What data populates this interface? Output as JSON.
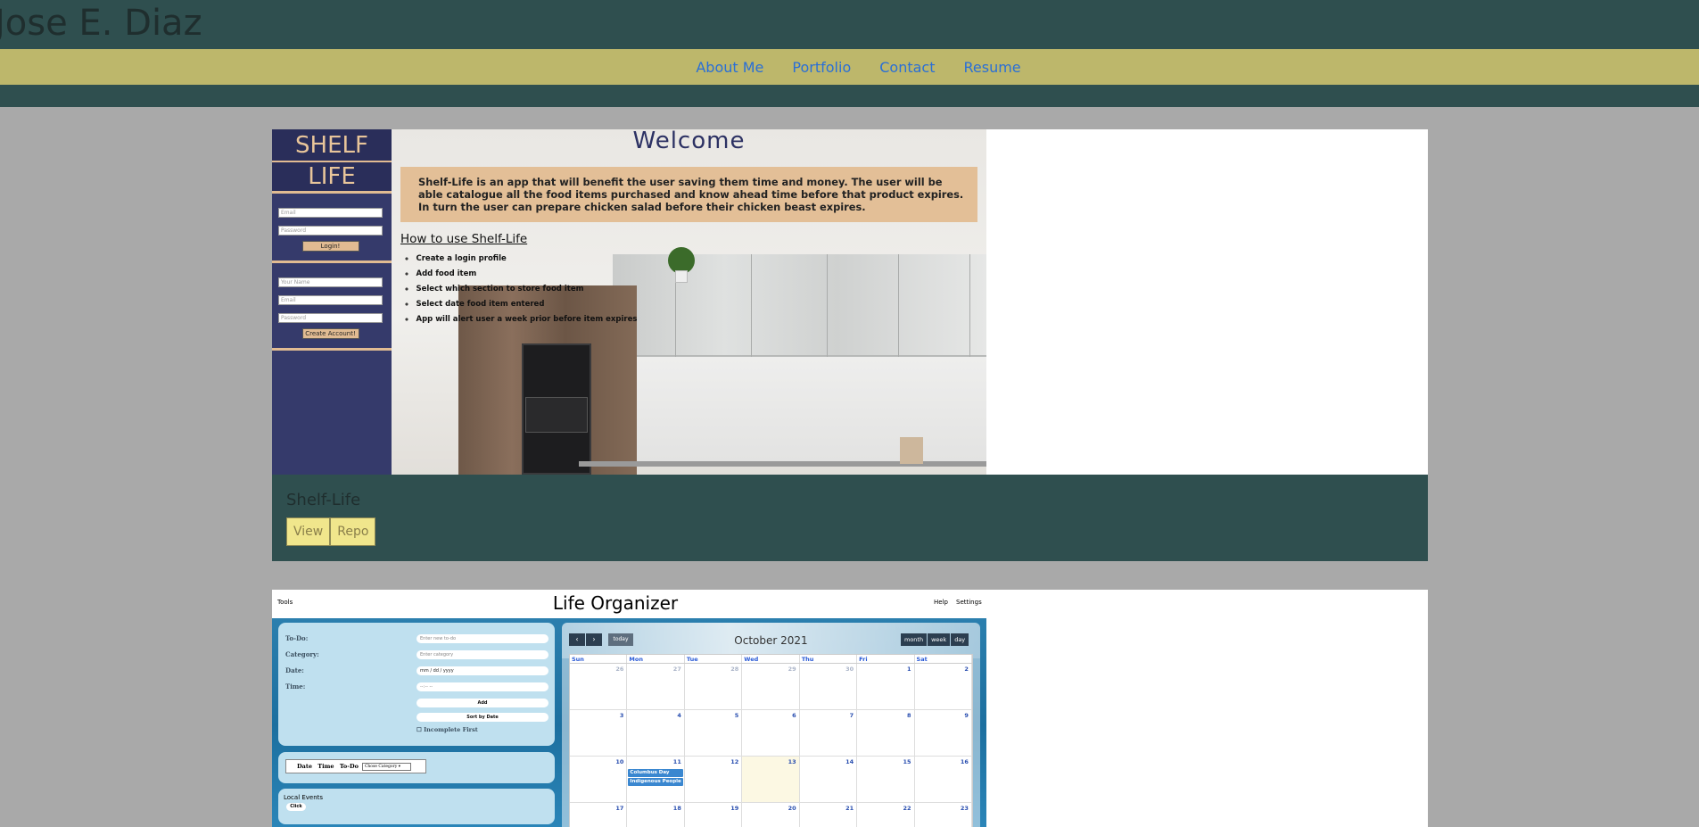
{
  "site": {
    "title": "Jose E. Diaz"
  },
  "nav": {
    "items": [
      "About Me",
      "Portfolio",
      "Contact",
      "Resume"
    ]
  },
  "projects": [
    {
      "name": "Shelf-Life",
      "buttons": [
        "View",
        "Repo"
      ],
      "preview": {
        "logo_line1": "SHELF",
        "logo_line2": "LIFE",
        "login": {
          "email_ph": "Email",
          "password_ph": "Password",
          "button": "Login!"
        },
        "signup": {
          "name_ph": "Your Name",
          "email_ph": "Email",
          "password_ph": "Password",
          "button": "Create Account!"
        },
        "welcome": "Welcome",
        "description": "Shelf-Life is an app that will benefit the user saving them time and money. The user will be able catalogue all the food items purchased and know ahead time before that product expires. In turn the user can prepare chicken salad before their chicken beast expires.",
        "how_title": "How to use Shelf-Life",
        "steps": [
          "Create a login profile",
          "Add food item",
          "Select which section to store food item",
          "Select date food item entered",
          "App will alert user a week prior before item expires"
        ]
      }
    },
    {
      "preview": {
        "tools": "Tools",
        "title": "Life Organizer",
        "help": "Help",
        "settings": "Settings",
        "labels": {
          "todo": "To-Do:",
          "category": "Category:",
          "date": "Date:",
          "time": "Time:"
        },
        "placeholders": {
          "todo": "Enter new to-do",
          "category": "Enter category",
          "date": "mm / dd / yyyy",
          "time": "--:-- --"
        },
        "buttons": {
          "add": "Add",
          "sort": "Sort by Date"
        },
        "checkbox": "Incomplete First",
        "table_header": "Date Time To-Do",
        "choose_category": "Chose Category",
        "local_events": "Local Events",
        "click": "Click",
        "calendar": {
          "month": "October 2021",
          "today": "today",
          "views": [
            "month",
            "week",
            "day"
          ],
          "days": [
            "Sun",
            "Mon",
            "Tue",
            "Wed",
            "Thu",
            "Fri",
            "Sat"
          ],
          "weeks": [
            [
              "26",
              "27",
              "28",
              "29",
              "30",
              "1",
              "2"
            ],
            [
              "3",
              "4",
              "5",
              "6",
              "7",
              "8",
              "9"
            ],
            [
              "10",
              "11",
              "12",
              "13",
              "14",
              "15",
              "16"
            ],
            [
              "17",
              "18",
              "19",
              "20",
              "21",
              "22",
              "23"
            ]
          ],
          "events": [
            "Columbus Day",
            "Indigenous People"
          ]
        }
      }
    }
  ]
}
